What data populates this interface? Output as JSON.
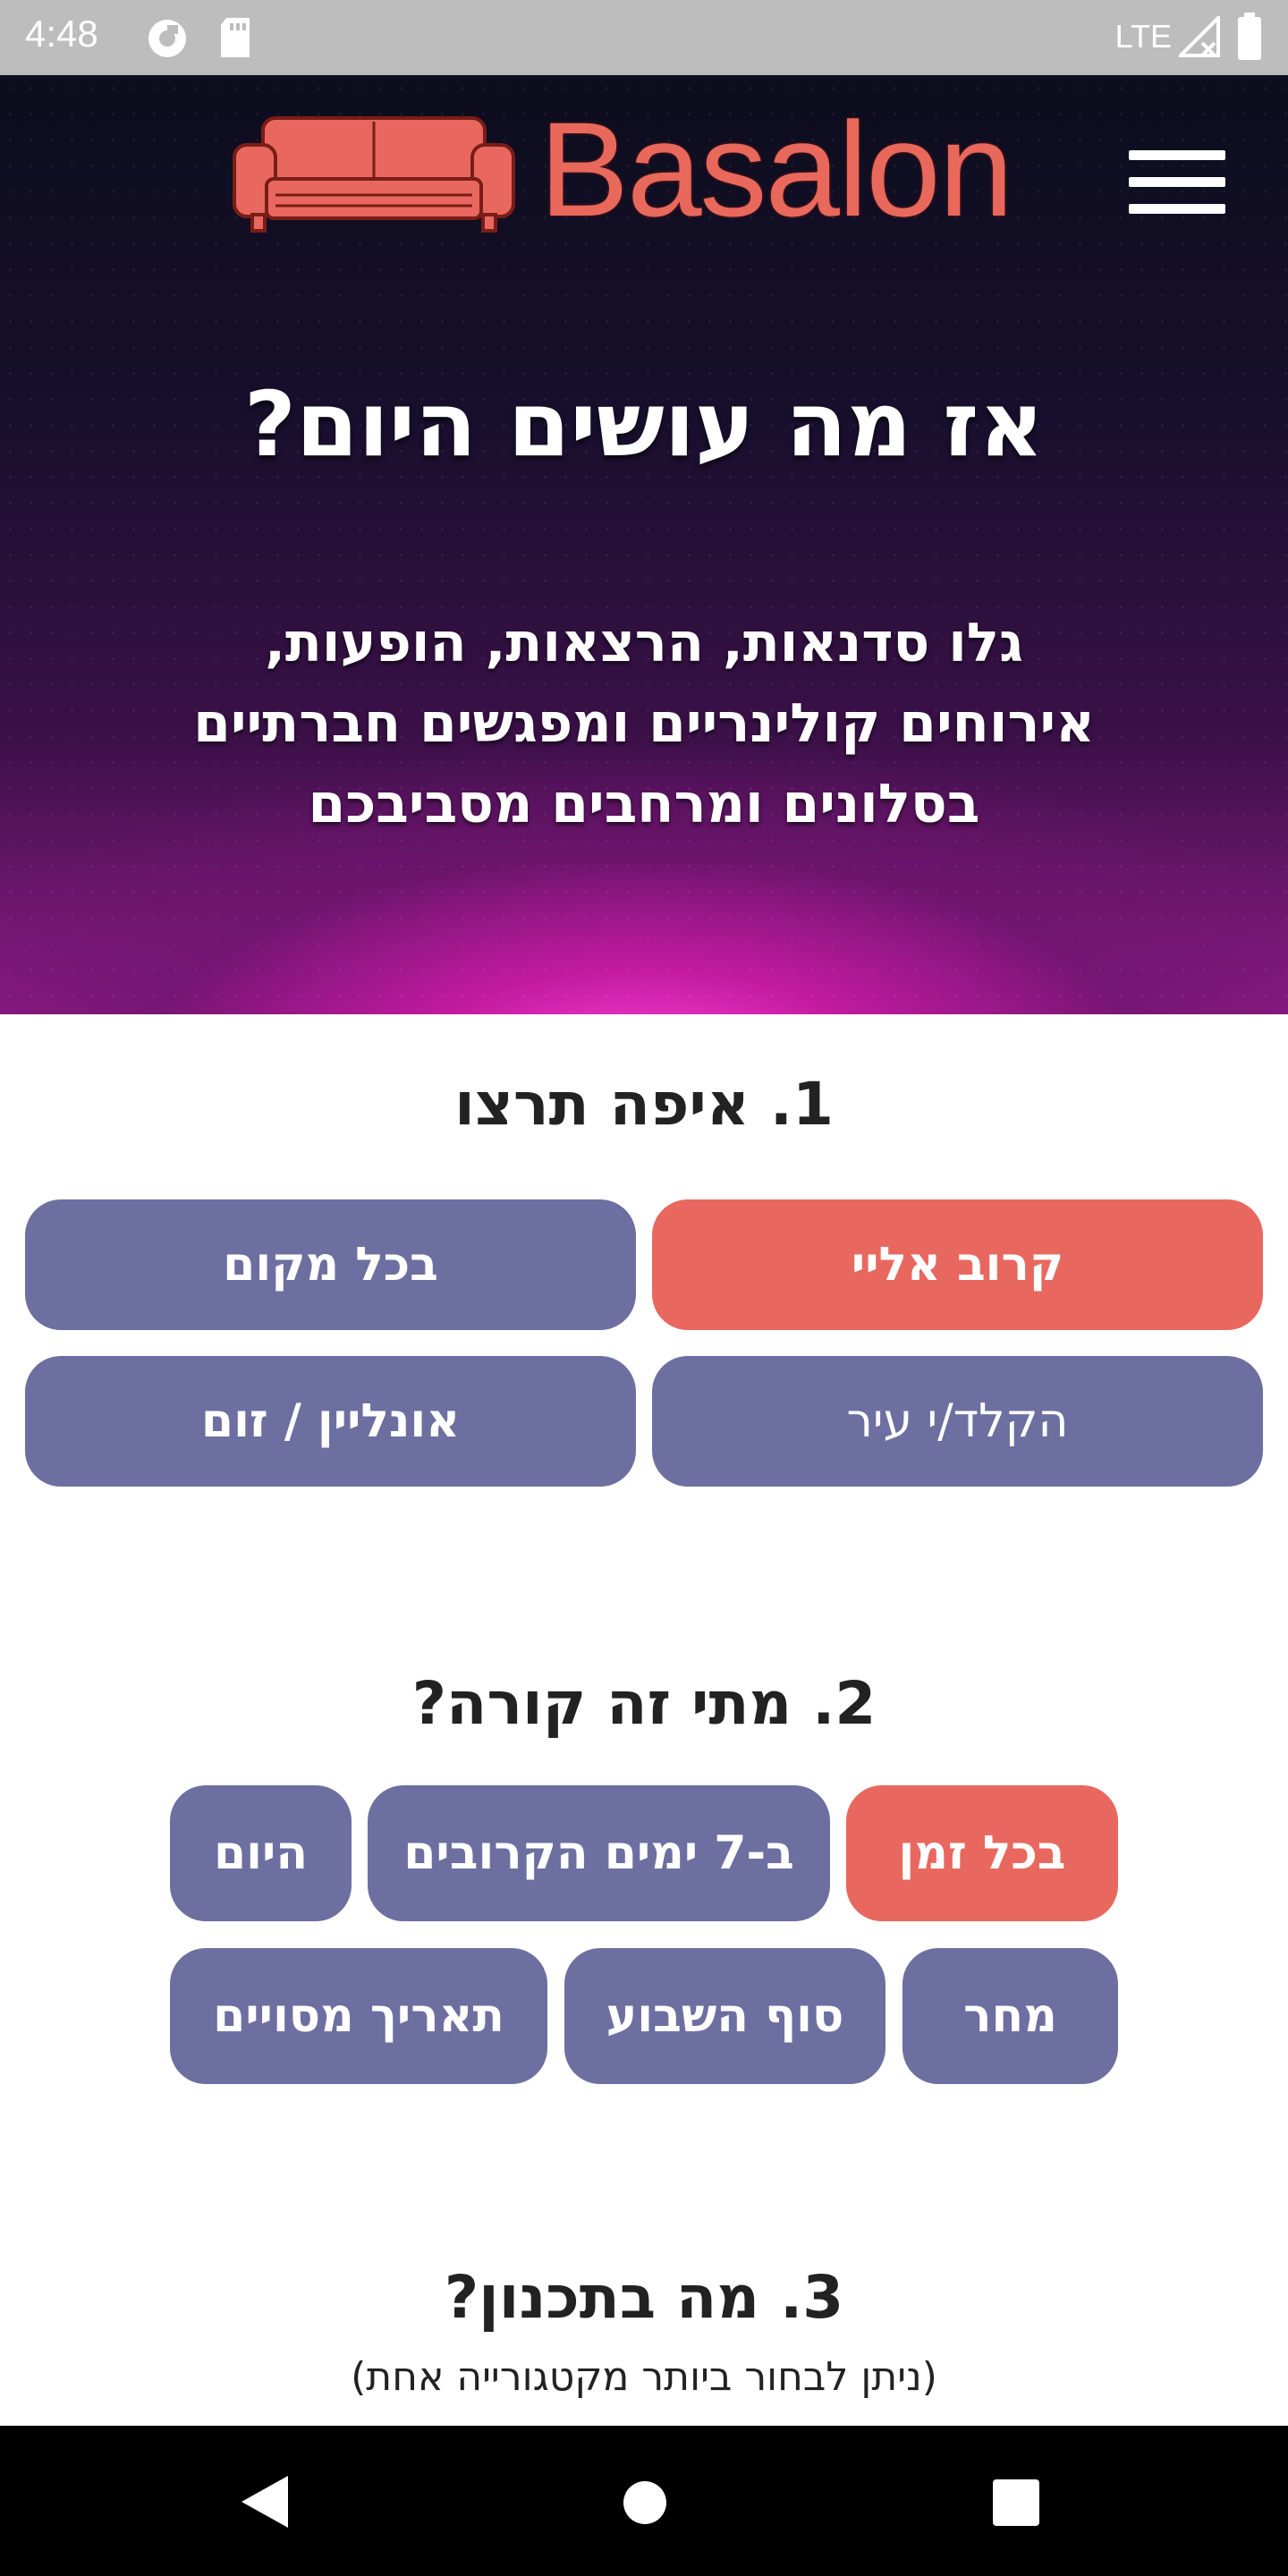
{
  "status_bar": {
    "time": "4:48",
    "network": "LTE",
    "icons": [
      "pocket-casts-icon",
      "sd-card-icon",
      "signal-icon",
      "battery-icon"
    ]
  },
  "header": {
    "logo_text": "Basalon",
    "logo_icon": "sofa-icon",
    "menu_icon": "hamburger-menu-icon"
  },
  "hero": {
    "title": "אז מה עושים היום?",
    "subtitle_lines": [
      "גלו סדנאות, הרצאות, הופעות,",
      "אירוחים קולינריים ומפגשים חברתיים",
      "בסלונים ומרחבים מסביבכם"
    ]
  },
  "section_where": {
    "title": "1. איפה תרצו",
    "options": [
      {
        "label": "קרוב אליי",
        "selected": true
      },
      {
        "label": "בכל מקום",
        "selected": false
      },
      {
        "label": "הקלד/י עיר",
        "selected": false,
        "is_input": true
      },
      {
        "label": "אונליין / זום",
        "selected": false
      }
    ]
  },
  "section_when": {
    "title": "2. מתי זה קורה?",
    "options": [
      {
        "label": "בכל זמן",
        "selected": true
      },
      {
        "label": "ב-7 ימים הקרובים",
        "selected": false
      },
      {
        "label": "היום",
        "selected": false
      },
      {
        "label": "מחר",
        "selected": false
      },
      {
        "label": "סוף השבוע",
        "selected": false
      },
      {
        "label": "תאריך מסויים",
        "selected": false
      }
    ]
  },
  "section_what": {
    "title": "3. מה בתכנון?",
    "note": "(ניתן לבחור ביותר מקטגורייה אחת)"
  },
  "colors": {
    "accent_red": "#e8685f",
    "option_purple": "#6d6fa0",
    "logo_red": "#e8695c",
    "status_bar": "#bdbdbd"
  }
}
